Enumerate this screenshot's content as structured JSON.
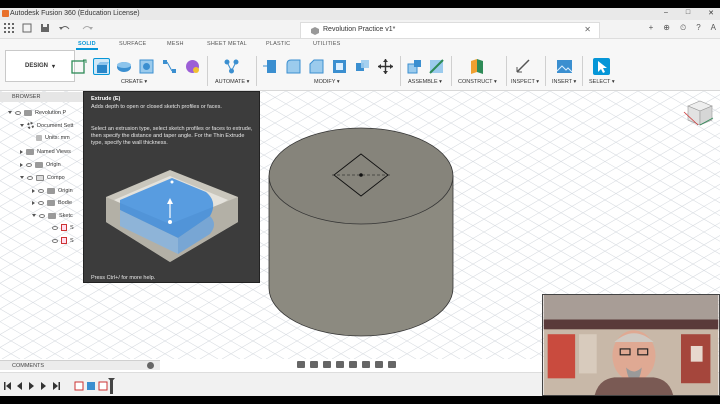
{
  "window": {
    "title": "Autodesk Fusion 360 (Education License)",
    "controls": [
      "–",
      "□",
      "✕"
    ]
  },
  "tabbar": {
    "doc_title": "Revolution Practice v1*",
    "close": "✕",
    "right_icons": [
      "+",
      "⊕",
      "⏲",
      "?",
      "A"
    ]
  },
  "ribbon": {
    "workspace": "DESIGN",
    "workspace_caret": "▾",
    "tabs": [
      "SOLID",
      "SURFACE",
      "MESH",
      "SHEET METAL",
      "PLASTIC",
      "UTILITIES"
    ],
    "active_tab": "SOLID",
    "groups": [
      "CREATE ▾",
      "AUTOMATE ▾",
      "MODIFY ▾",
      "ASSEMBLE ▾",
      "CONSTRUCT ▾",
      "INSPECT ▾",
      "INSERT ▾",
      "SELECT ▾"
    ]
  },
  "browser": {
    "header": "BROWSER",
    "items": [
      "Revolution P",
      "Document Sett",
      "Units: mm",
      "Named Views",
      "Origin",
      "Compo",
      "Origin",
      "Bodie",
      "Sketc",
      "S",
      "S"
    ]
  },
  "tooltip": {
    "title": "Extrude (E)",
    "description": "Adds depth to open or closed sketch profiles or faces.",
    "details": "Select an extrusion type, select sketch profiles or faces to extrude, then specify the distance and taper angle. For the Thin Extrude type, specify the wall thickness.",
    "footer": "Press Ctrl+/ for more help."
  },
  "comments": {
    "label": "COMMENTS"
  },
  "colors": {
    "accent": "#0696d7",
    "body": "#8c8a80",
    "tooltip_bg": "#3c3c3c"
  }
}
